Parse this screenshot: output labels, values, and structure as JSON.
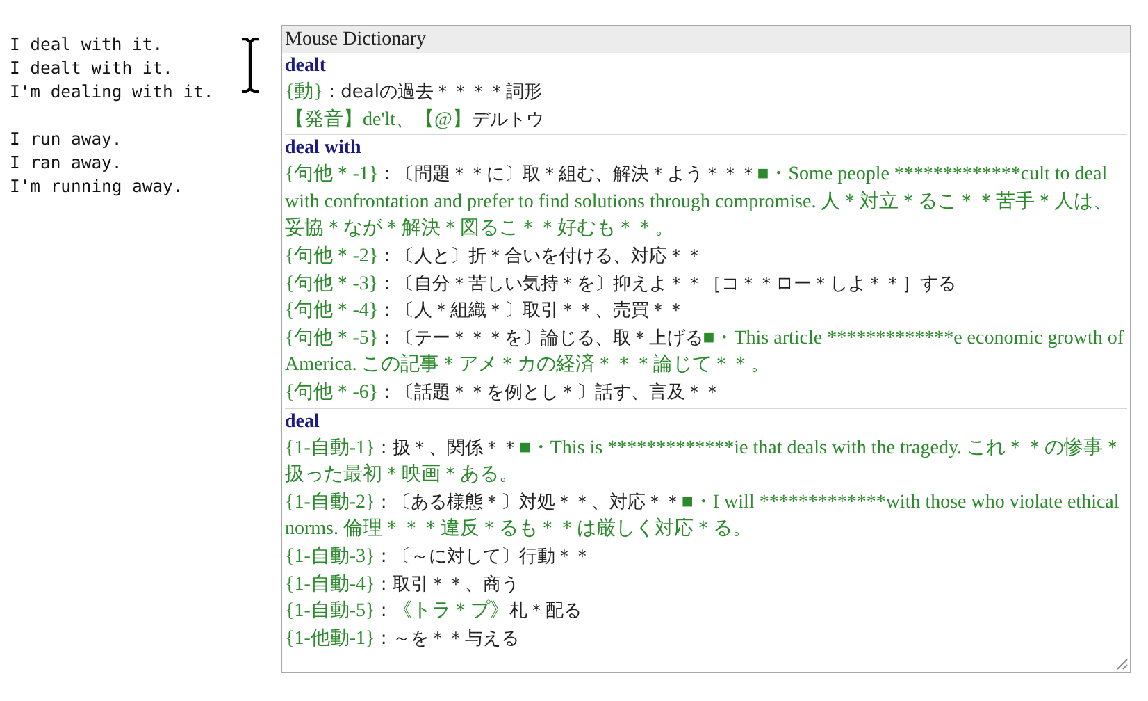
{
  "editor_paragraphs": [
    [
      "I deal with it.",
      "I dealt with it.",
      "I'm dealing with it."
    ],
    [
      "I run away.",
      "I ran away.",
      "I'm running away."
    ]
  ],
  "dictionary": {
    "title": "Mouse Dictionary",
    "entries": [
      {
        "headword": "dealt",
        "senses": [
          {
            "parts": [
              {
                "kind": "label",
                "text": "{動}"
              },
              {
                "kind": "text",
                "text": " : dealの過去＊＊＊＊詞形"
              }
            ]
          },
          {
            "parts": [
              {
                "kind": "label",
                "text": "【発音】de'lt、【@】"
              },
              {
                "kind": "text",
                "text": "デルトウ"
              }
            ]
          }
        ]
      },
      {
        "headword": "deal with",
        "senses": [
          {
            "parts": [
              {
                "kind": "label",
                "text": "{句他＊-1}"
              },
              {
                "kind": "text",
                "text": " : 〔問題＊＊に〕取＊組む、解決＊よう＊＊＊"
              },
              {
                "kind": "example",
                "text": "■・Some people *************cult to deal with confrontation and prefer to find solutions through compromise. 人＊対立＊るこ＊＊苦手＊人は、妥協＊なが＊解決＊図るこ＊＊好むも＊＊。"
              }
            ]
          },
          {
            "parts": [
              {
                "kind": "label",
                "text": "{句他＊-2}"
              },
              {
                "kind": "text",
                "text": " : 〔人と〕折＊合いを付ける、対応＊＊"
              }
            ]
          },
          {
            "parts": [
              {
                "kind": "label",
                "text": "{句他＊-3}"
              },
              {
                "kind": "text",
                "text": " : 〔自分＊苦しい気持＊を〕抑えよ＊＊［コ＊＊ロー＊しよ＊＊］する"
              }
            ]
          },
          {
            "parts": [
              {
                "kind": "label",
                "text": "{句他＊-4}"
              },
              {
                "kind": "text",
                "text": " : 〔人＊組織＊〕取引＊＊、売買＊＊"
              }
            ]
          },
          {
            "parts": [
              {
                "kind": "label",
                "text": "{句他＊-5}"
              },
              {
                "kind": "text",
                "text": " : 〔テー＊＊＊を〕論じる、取＊上げる"
              },
              {
                "kind": "example",
                "text": "■・This article *************e economic growth of America. この記事＊アメ＊カの経済＊＊＊論じて＊＊。"
              }
            ]
          },
          {
            "parts": [
              {
                "kind": "label",
                "text": "{句他＊-6}"
              },
              {
                "kind": "text",
                "text": " : 〔話題＊＊を例とし＊〕話す、言及＊＊"
              }
            ]
          }
        ]
      },
      {
        "headword": "deal",
        "senses": [
          {
            "parts": [
              {
                "kind": "label",
                "text": "{1-自動-1}"
              },
              {
                "kind": "text",
                "text": " : 扱＊、関係＊＊"
              },
              {
                "kind": "example",
                "text": "■・This is *************ie that deals with the tragedy. これ＊＊の惨事＊扱った最初＊映画＊ある。"
              }
            ]
          },
          {
            "parts": [
              {
                "kind": "label",
                "text": "{1-自動-2}"
              },
              {
                "kind": "text",
                "text": " : 〔ある様態＊〕対処＊＊、対応＊＊"
              },
              {
                "kind": "example",
                "text": "■・I will *************with those who violate ethical norms. 倫理＊＊＊違反＊るも＊＊は厳しく対応＊る。"
              }
            ]
          },
          {
            "parts": [
              {
                "kind": "label",
                "text": "{1-自動-3}"
              },
              {
                "kind": "text",
                "text": " : 〔～に対して〕行動＊＊"
              }
            ]
          },
          {
            "parts": [
              {
                "kind": "label",
                "text": "{1-自動-4}"
              },
              {
                "kind": "text",
                "text": " : 取引＊＊、商う"
              }
            ]
          },
          {
            "parts": [
              {
                "kind": "label",
                "text": "{1-自動-5}"
              },
              {
                "kind": "text",
                "text": " : "
              },
              {
                "kind": "example",
                "text": "《トラ＊プ》"
              },
              {
                "kind": "text",
                "text": "札＊配る"
              }
            ]
          },
          {
            "parts": [
              {
                "kind": "label",
                "text": "{1-他動-1}"
              },
              {
                "kind": "text",
                "text": " : ～を＊＊与える"
              }
            ]
          }
        ]
      }
    ]
  }
}
